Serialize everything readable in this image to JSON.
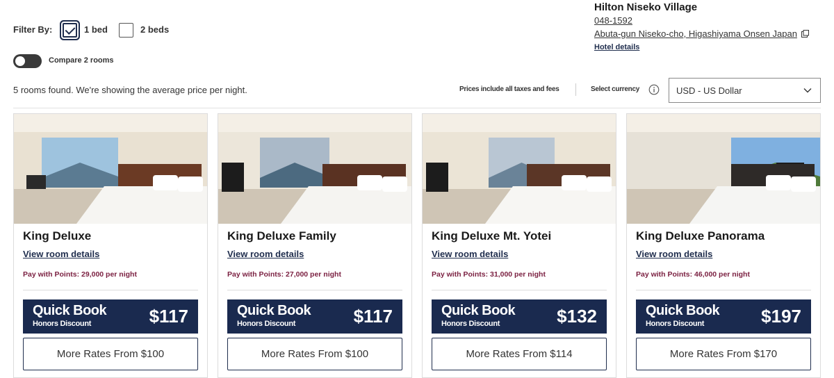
{
  "filters": {
    "label": "Filter By:",
    "options": [
      {
        "label": "1 bed",
        "checked": true
      },
      {
        "label": "2 beds",
        "checked": false
      }
    ]
  },
  "compare": {
    "label": "Compare 2 rooms",
    "on": false
  },
  "hotel": {
    "name": "Hilton Niseko Village",
    "postal": "048-1592",
    "address": "Abuta-gun Niseko-cho, Higashiyama Onsen Japan",
    "details_link": "Hotel details"
  },
  "results": {
    "summary": "5 rooms found. We're showing the average price per night.",
    "prices_note": "Prices include all taxes and fees",
    "currency_label": "Select currency",
    "currency_value": "USD - US Dollar"
  },
  "rooms": [
    {
      "title": "King Deluxe",
      "details_link": "View room details",
      "points": "Pay with Points: 29,000 per night",
      "quick_book": "Quick Book",
      "discount": "Honors Discount",
      "price": "$117",
      "more_rates": "More Rates From $100"
    },
    {
      "title": "King Deluxe Family",
      "details_link": "View room details",
      "points": "Pay with Points: 27,000 per night",
      "quick_book": "Quick Book",
      "discount": "Honors Discount",
      "price": "$117",
      "more_rates": "More Rates From $100"
    },
    {
      "title": "King Deluxe Mt. Yotei",
      "details_link": "View room details",
      "points": "Pay with Points: 31,000 per night",
      "quick_book": "Quick Book",
      "discount": "Honors Discount",
      "price": "$132",
      "more_rates": "More Rates From $114"
    },
    {
      "title": "King Deluxe Panorama",
      "details_link": "View room details",
      "points": "Pay with Points: 46,000 per night",
      "quick_book": "Quick Book",
      "discount": "Honors Discount",
      "price": "$197",
      "more_rates": "More Rates From $170"
    }
  ],
  "colors": {
    "brand_navy": "#1a2a4f",
    "points_maroon": "#7a1f40"
  }
}
